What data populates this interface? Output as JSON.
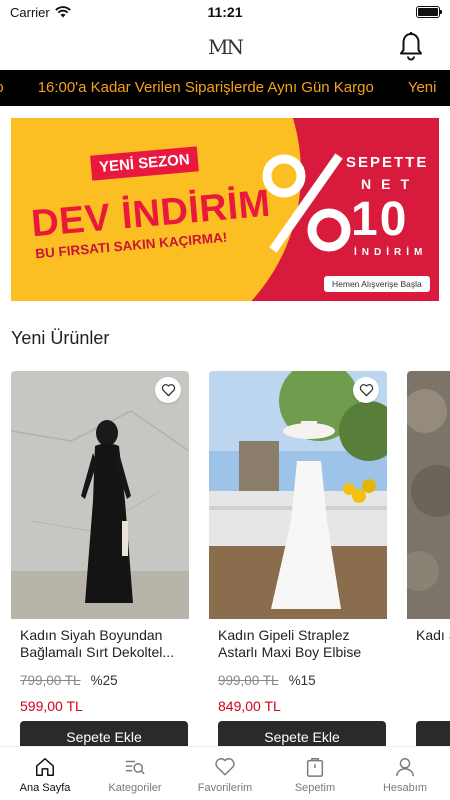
{
  "status": {
    "carrier": "Carrier",
    "time": "11:21"
  },
  "header": {
    "logo": "MN"
  },
  "marquee": {
    "items": [
      "rgo",
      "16:00'a Kadar Verilen Siparişlerde Aynı Gün Kargo",
      "Yeni"
    ]
  },
  "banner": {
    "season": "YENİ SEZON",
    "headline": "DEV İNDİRİM",
    "subline": "BU FIRSATI SAKIN KAÇIRMA!",
    "sepette": "SEPETTE",
    "net": "NET",
    "value": "10",
    "indirim": "İNDİRİM",
    "cta": "Hemen Alışverişe Başla"
  },
  "section": {
    "title": "Yeni Ürünler"
  },
  "products": [
    {
      "name": "Kadın Siyah Boyundan Bağlamalı Sırt Dekoltel...",
      "old_price": "799,00 TL",
      "discount": "%25",
      "price": "599,00 TL",
      "button": "Sepete Ekle"
    },
    {
      "name": "Kadın Gipeli Straplez Astarlı Maxi Boy Elbise",
      "old_price": "999,00 TL",
      "discount": "%15",
      "price": "849,00 TL",
      "button": "Sepete Ekle"
    },
    {
      "name": "Kadı Sırt D",
      "old_price": "",
      "discount": "",
      "price": "",
      "button": ""
    }
  ],
  "tabs": [
    {
      "label": "Ana Sayfa",
      "icon": "home-icon"
    },
    {
      "label": "Kategoriler",
      "icon": "categories-icon"
    },
    {
      "label": "Favorilerim",
      "icon": "heart-icon"
    },
    {
      "label": "Sepetim",
      "icon": "cart-icon"
    },
    {
      "label": "Hesabım",
      "icon": "user-icon"
    }
  ],
  "colors": {
    "accent": "#f5a21a",
    "brand_red": "#d81b3c",
    "price_red": "#d0021b",
    "button_dark": "#2a2a2a"
  }
}
